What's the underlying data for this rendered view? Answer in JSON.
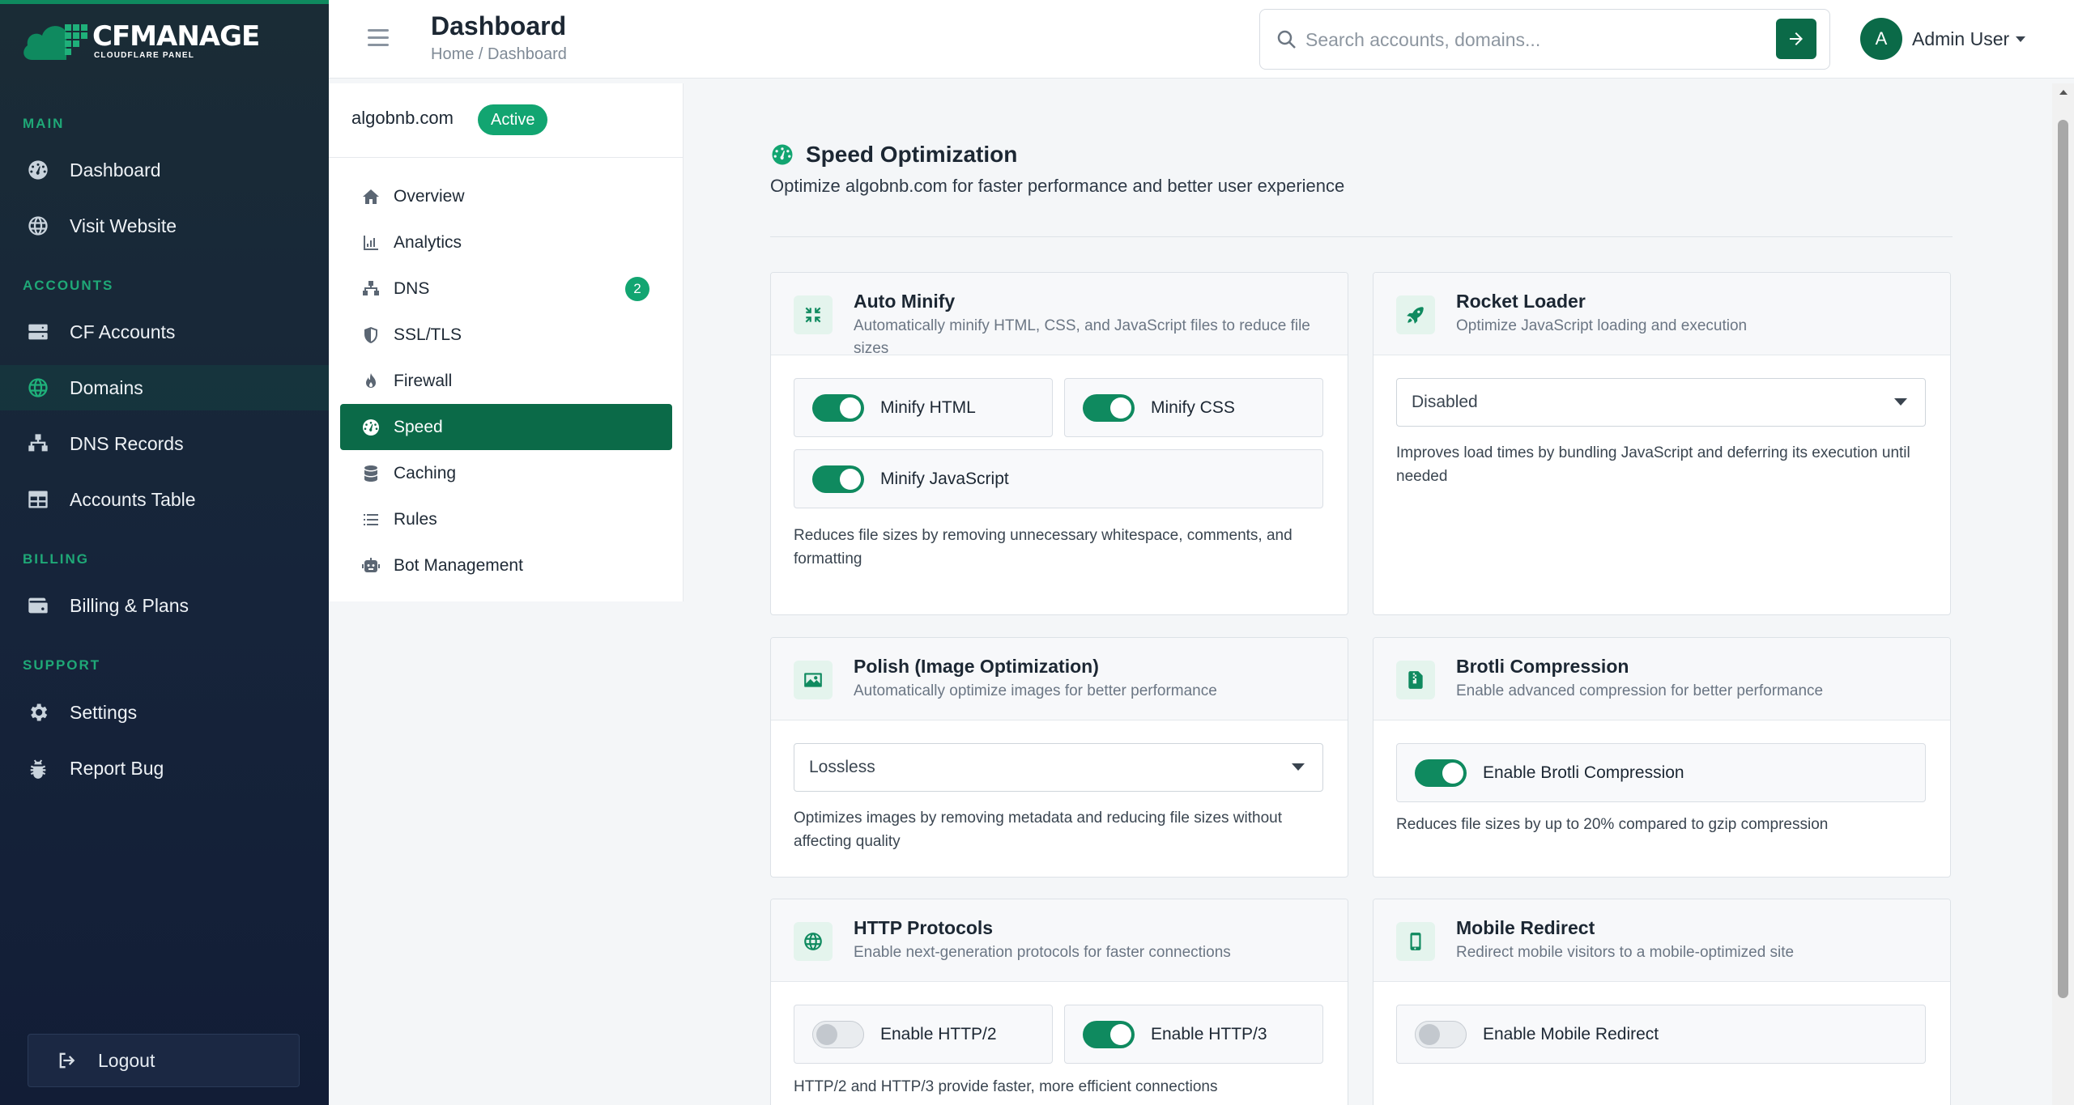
{
  "brand": {
    "name": "CFMANAGE",
    "subtitle": "CLOUDFLARE PANEL"
  },
  "sidebar": {
    "sections": [
      {
        "label": "MAIN"
      },
      {
        "label": "ACCOUNTS"
      },
      {
        "label": "BILLING"
      },
      {
        "label": "SUPPORT"
      }
    ],
    "items": [
      {
        "label": "Dashboard",
        "icon": "dashboard-icon"
      },
      {
        "label": "Visit Website",
        "icon": "globe-icon"
      },
      {
        "label": "CF Accounts",
        "icon": "server-icon"
      },
      {
        "label": "Domains",
        "icon": "globe-icon"
      },
      {
        "label": "DNS Records",
        "icon": "sitemap-icon"
      },
      {
        "label": "Accounts Table",
        "icon": "table-icon"
      },
      {
        "label": "Billing & Plans",
        "icon": "wallet-icon"
      },
      {
        "label": "Settings",
        "icon": "gear-icon"
      },
      {
        "label": "Report Bug",
        "icon": "bug-icon"
      }
    ],
    "logout": "Logout"
  },
  "topbar": {
    "title": "Dashboard",
    "breadcrumb": "Home / Dashboard",
    "search_placeholder": "Search accounts, domains...",
    "avatar_initial": "A",
    "user_name": "Admin User"
  },
  "domain": {
    "name": "algobnb.com",
    "status": "Active",
    "nav": [
      {
        "label": "Overview"
      },
      {
        "label": "Analytics"
      },
      {
        "label": "DNS",
        "badge": "2"
      },
      {
        "label": "SSL/TLS"
      },
      {
        "label": "Firewall"
      },
      {
        "label": "Speed"
      },
      {
        "label": "Caching"
      },
      {
        "label": "Rules"
      },
      {
        "label": "Bot Management"
      }
    ]
  },
  "main": {
    "title": "Speed Optimization",
    "subtitle": "Optimize algobnb.com for faster performance and better user experience",
    "cards": {
      "auto_minify": {
        "title": "Auto Minify",
        "desc": "Automatically minify HTML, CSS, and JavaScript files to reduce file sizes",
        "toggles": [
          {
            "label": "Minify HTML",
            "on": true
          },
          {
            "label": "Minify CSS",
            "on": true
          },
          {
            "label": "Minify JavaScript",
            "on": true
          }
        ],
        "help": "Reduces file sizes by removing unnecessary whitespace, comments, and formatting"
      },
      "rocket_loader": {
        "title": "Rocket Loader",
        "desc": "Optimize JavaScript loading and execution",
        "select": "Disabled",
        "help": "Improves load times by bundling JavaScript and deferring its execution until needed"
      },
      "polish": {
        "title": "Polish (Image Optimization)",
        "desc": "Automatically optimize images for better performance",
        "select": "Lossless",
        "help": "Optimizes images by removing metadata and reducing file sizes without affecting quality"
      },
      "brotli": {
        "title": "Brotli Compression",
        "desc": "Enable advanced compression for better performance",
        "toggle": {
          "label": "Enable Brotli Compression",
          "on": true
        },
        "help": "Reduces file sizes by up to 20% compared to gzip compression"
      },
      "http": {
        "title": "HTTP Protocols",
        "desc": "Enable next-generation protocols for faster connections",
        "toggles": [
          {
            "label": "Enable HTTP/2",
            "on": false
          },
          {
            "label": "Enable HTTP/3",
            "on": true
          }
        ],
        "help": "HTTP/2 and HTTP/3 provide faster, more efficient connections"
      },
      "mobile": {
        "title": "Mobile Redirect",
        "desc": "Redirect mobile visitors to a mobile-optimized site",
        "toggle": {
          "label": "Enable Mobile Redirect",
          "on": false
        }
      }
    }
  },
  "colors": {
    "accent": "#0f8a5f",
    "accent_dark": "#0b6a48",
    "badge": "#12a571",
    "sidebar_bg": "#16243a"
  }
}
